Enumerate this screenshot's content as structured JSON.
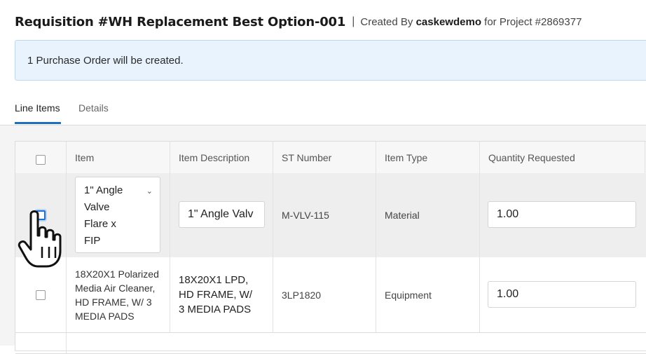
{
  "header": {
    "title": "Requisition #WH Replacement Best Option-001",
    "separator": "|",
    "created_by_prefix": "Created By",
    "created_by_user": "caskewdemo",
    "project_text": "for Project #2869377"
  },
  "banner": {
    "message": "1 Purchase Order will be created."
  },
  "tabs": [
    {
      "label": "Line Items",
      "active": true
    },
    {
      "label": "Details",
      "active": false
    }
  ],
  "table": {
    "columns": [
      "Item",
      "Item Description",
      "ST Number",
      "Item Type",
      "Quantity Requested"
    ],
    "rows": [
      {
        "item": "1\" Angle Valve Flare x FIP",
        "item_lines": [
          "1\" Angle",
          "Valve",
          "Flare x",
          "FIP"
        ],
        "description": "1\" Angle Valv",
        "st_number": "M-VLV-115",
        "item_type": "Material",
        "quantity": "1.00"
      },
      {
        "item_lines": [
          "18X20X1 Polarized",
          "Media Air Cleaner,",
          "HD FRAME, W/ 3",
          "MEDIA PADS"
        ],
        "description_lines": [
          "18X20X1 LPD,",
          "HD FRAME, W/",
          "3 MEDIA PADS"
        ],
        "st_number": "3LP1820",
        "item_type": "Equipment",
        "quantity": "1.00"
      }
    ]
  },
  "icons": {
    "dropdown": "chevron-down-icon",
    "pointer": "hand-pointer-cursor-icon"
  },
  "colors": {
    "accent": "#1f6fbf",
    "banner_bg": "#e8f3fd",
    "banner_border": "#bcd8f1"
  }
}
